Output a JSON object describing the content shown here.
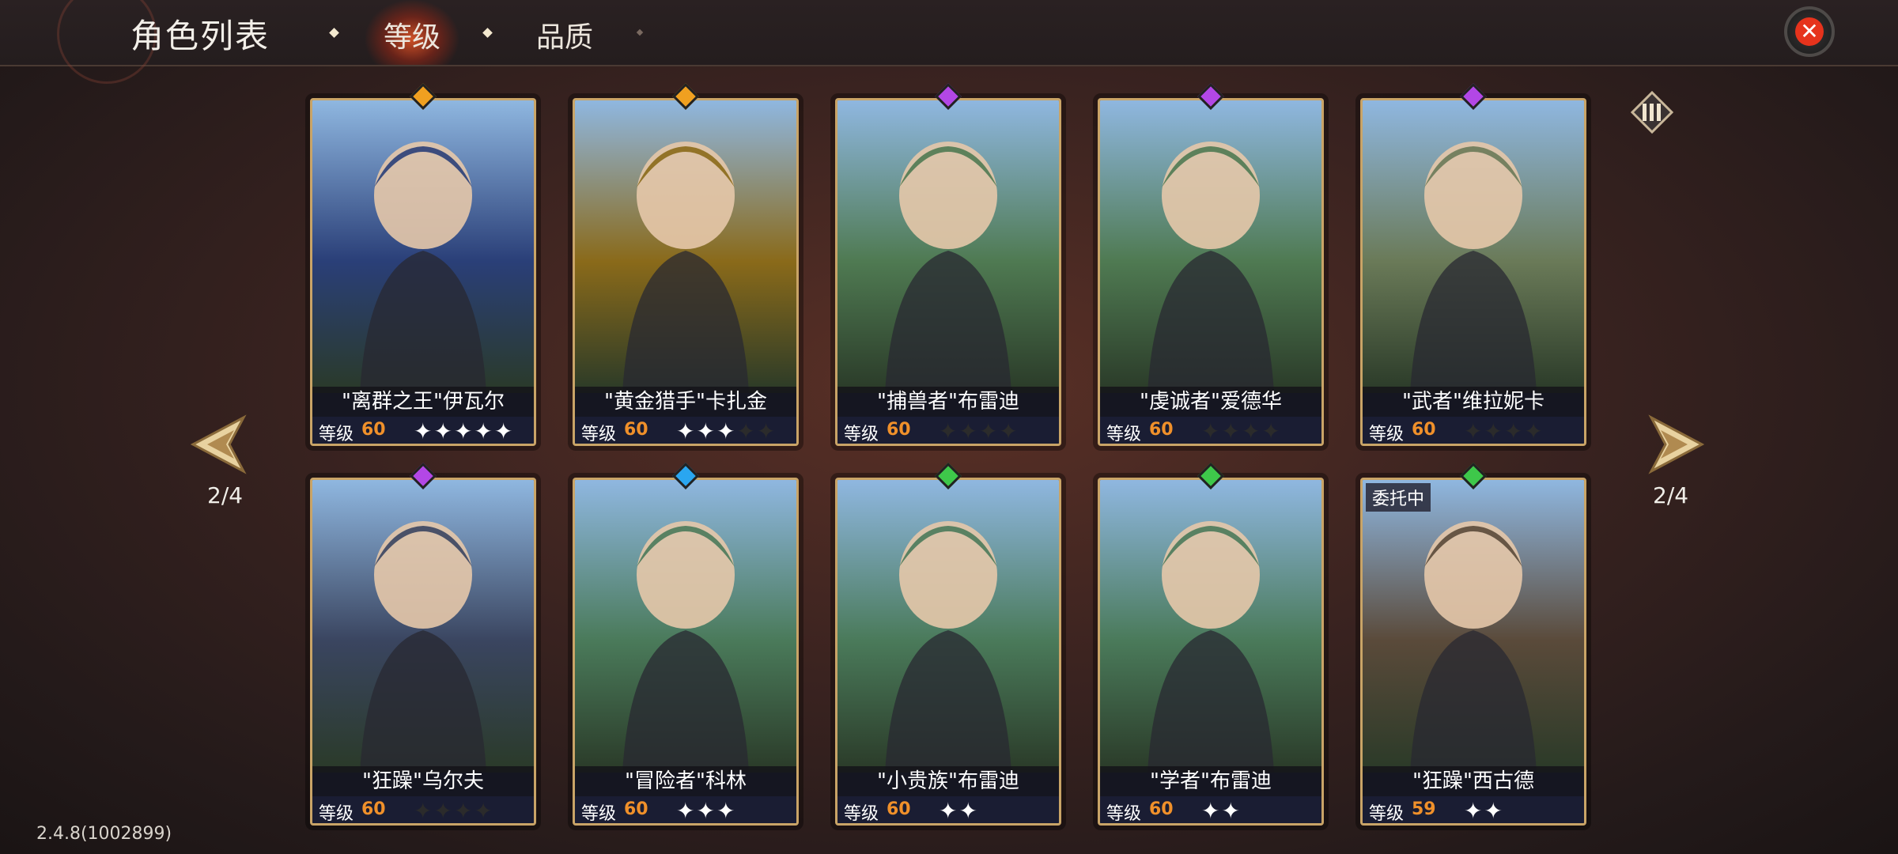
{
  "header": {
    "title": "角色列表",
    "tabs": [
      {
        "label": "等级",
        "active": true
      },
      {
        "label": "品质",
        "active": false
      }
    ],
    "close_icon": "close-icon"
  },
  "nav": {
    "left_page": "2/4",
    "right_page": "2/4"
  },
  "version": "2.4.8(1002899)",
  "level_label": "等级",
  "cards": [
    {
      "name": "\"离群之王\"伊瓦尔",
      "level": "60",
      "stars": 5,
      "max_stars": 5,
      "gem_color": "#f0a020",
      "bg": "#2a3f78",
      "badge": ""
    },
    {
      "name": "\"黄金猎手\"卡扎金",
      "level": "60",
      "stars": 3,
      "max_stars": 5,
      "gem_color": "#f0a020",
      "bg": "#8a6a1a",
      "badge": ""
    },
    {
      "name": "\"捕兽者\"布雷迪",
      "level": "60",
      "stars": 0,
      "max_stars": 4,
      "gem_color": "#b347e6",
      "bg": "#4f7a52",
      "badge": ""
    },
    {
      "name": "\"虔诚者\"爱德华",
      "level": "60",
      "stars": 0,
      "max_stars": 4,
      "gem_color": "#b347e6",
      "bg": "#4f7a52",
      "badge": ""
    },
    {
      "name": "\"武者\"维拉妮卡",
      "level": "60",
      "stars": 0,
      "max_stars": 4,
      "gem_color": "#b347e6",
      "bg": "#6a7a58",
      "badge": ""
    },
    {
      "name": "\"狂躁\"乌尔夫",
      "level": "60",
      "stars": 0,
      "max_stars": 4,
      "gem_color": "#b347e6",
      "bg": "#3a4560",
      "badge": ""
    },
    {
      "name": "\"冒险者\"科林",
      "level": "60",
      "stars": 3,
      "max_stars": 3,
      "gem_color": "#2aa6f0",
      "bg": "#4a7a5a",
      "badge": ""
    },
    {
      "name": "\"小贵族\"布雷迪",
      "level": "60",
      "stars": 2,
      "max_stars": 2,
      "gem_color": "#3ec84a",
      "bg": "#4a7a5a",
      "badge": ""
    },
    {
      "name": "\"学者\"布雷迪",
      "level": "60",
      "stars": 2,
      "max_stars": 2,
      "gem_color": "#3ec84a",
      "bg": "#4a7a5a",
      "badge": ""
    },
    {
      "name": "\"狂躁\"西古德",
      "level": "59",
      "stars": 2,
      "max_stars": 2,
      "gem_color": "#3ec84a",
      "bg": "#5a4a3a",
      "badge": "委托中"
    }
  ]
}
